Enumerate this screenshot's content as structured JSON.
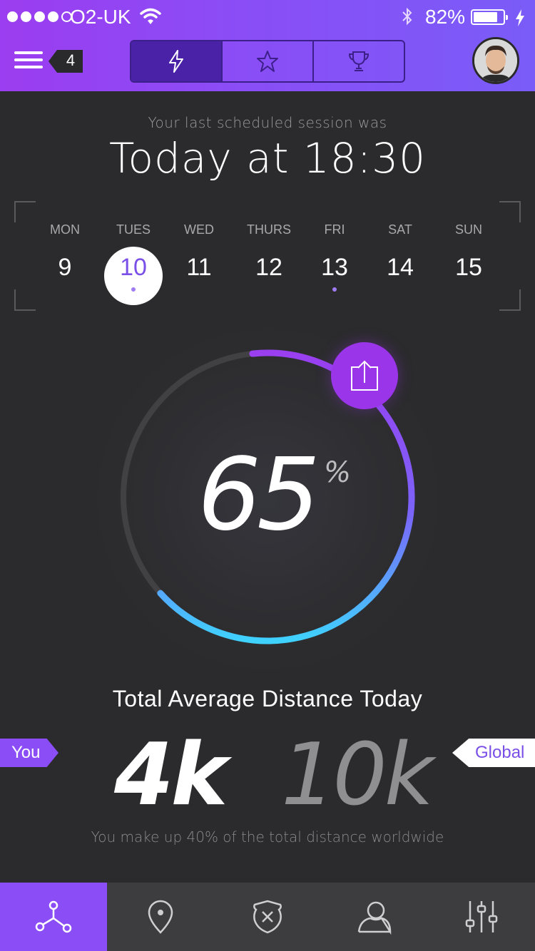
{
  "status_bar": {
    "carrier": "O2-UK",
    "battery_percent": "82%",
    "signal_bars_filled": 4,
    "signal_bars_total": 5
  },
  "header": {
    "notification_count": "4",
    "tabs": [
      {
        "icon": "lightning-icon",
        "active": true
      },
      {
        "icon": "star-icon",
        "active": false
      },
      {
        "icon": "trophy-icon",
        "active": false
      }
    ],
    "accent_color": "#8a4df6"
  },
  "session": {
    "subtitle": "Your last scheduled session was",
    "time": "Today at 18:30"
  },
  "calendar": {
    "days": [
      {
        "name": "MON",
        "num": "9",
        "selected": false,
        "dot": false
      },
      {
        "name": "TUES",
        "num": "10",
        "selected": true,
        "dot": true
      },
      {
        "name": "WED",
        "num": "11",
        "selected": false,
        "dot": false
      },
      {
        "name": "THURS",
        "num": "12",
        "selected": false,
        "dot": false
      },
      {
        "name": "FRI",
        "num": "13",
        "selected": false,
        "dot": true
      },
      {
        "name": "SAT",
        "num": "14",
        "selected": false,
        "dot": false
      },
      {
        "name": "SUN",
        "num": "15",
        "selected": false,
        "dot": false
      }
    ]
  },
  "progress": {
    "value": "65",
    "unit": "%",
    "fraction": 0.65
  },
  "distance": {
    "title": "Total Average Distance Today",
    "you_label": "You",
    "you_value": "4k",
    "global_label": "Global",
    "global_value": "10k",
    "note": "You make up 40% of the total distance worldwide"
  },
  "bottom_nav": [
    {
      "icon": "network-icon",
      "active": true
    },
    {
      "icon": "location-pin-icon",
      "active": false
    },
    {
      "icon": "shield-icon",
      "active": false
    },
    {
      "icon": "user-icon",
      "active": false
    },
    {
      "icon": "sliders-icon",
      "active": false
    }
  ]
}
